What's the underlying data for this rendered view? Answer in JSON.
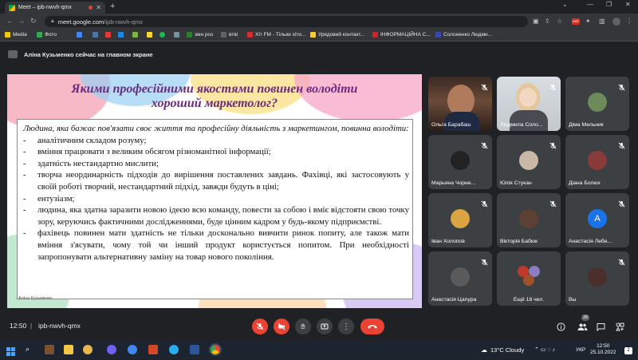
{
  "browser": {
    "tab_title": "Meet – ipb-nwvh-qmx",
    "url_host": "meet.google.com",
    "url_path": "/ipb-nwvh-qmx"
  },
  "bookmarks": [
    {
      "label": "Media",
      "color": "#f1c40f"
    },
    {
      "label": "Фото",
      "color": "#34a853"
    },
    {
      "label": "",
      "color": "#4285f4"
    },
    {
      "label": "",
      "color": "#4a76a8"
    },
    {
      "label": "",
      "color": "#e53935"
    },
    {
      "label": "",
      "color": "#1e88e5"
    },
    {
      "label": "",
      "color": "#7cb342"
    },
    {
      "label": "",
      "color": "#fdd835"
    },
    {
      "label": "",
      "color": "#1db954"
    },
    {
      "label": "",
      "color": "#78909c"
    },
    {
      "label": "змн роз",
      "color": "#2e7d32"
    },
    {
      "label": "втві",
      "color": "#5f6368"
    },
    {
      "label": "Хіт FM - Тільки хіти...",
      "color": "#d32f2f"
    },
    {
      "label": "Урядовий контакт...",
      "color": "#ffca28"
    },
    {
      "label": "ІНФОРМАЦІЙНА С...",
      "color": "#c62828"
    },
    {
      "label": "Солоненко Людми...",
      "color": "#3949ab"
    }
  ],
  "banner": "Аліна Кузьменко сейчас на главном экране",
  "slide": {
    "title": "Якими професійними якостями повинен володіти хороший маркетолог?",
    "intro": "Людина, яка бажає пов'язати своє життя та професійну діяльність з маркетингом, повинна володіти:",
    "items": [
      "аналітичним складом розуму;",
      "вміння працювати з великим обсягом різноманітної інформації;",
      "здатність нестандартно мислити;",
      "творча неординарність підходів до вирішення поставлених завдань. Фахівці, які застосовують у своїй роботі творчий, нестандартний підхід, завжди будуть в ціні;",
      "ентузіазм;",
      "людина, яка здатна заразити новою ідеєю всю команду, повести за собою і вміє відстояти свою точку зору, керуючись фактичними дослідженнями, буде цінним кадром у будь-якому підприємстві.",
      "фахівець повинен мати здатність не тільки досконально вивчити ринок попиту, але також мати вміння з'ясувати, чому той чи інший продукт користується попитом. При необхідності запропонувати альтернативну заміну на товар нового покоління."
    ],
    "caption": "Аліна Кузьменко"
  },
  "participants": [
    {
      "name": "Ольга Барабаш",
      "type": "video"
    },
    {
      "name": "Людмила Соло...",
      "type": "video"
    },
    {
      "name": "Діма Мельник",
      "type": "avatar",
      "color": "#6d8a5a"
    },
    {
      "name": "Марьяна Чорне...",
      "type": "avatar",
      "color": "#222222"
    },
    {
      "name": "Юлія Стукан",
      "type": "avatar",
      "color": "#c9b8a6"
    },
    {
      "name": "Діана Болюх",
      "type": "avatar",
      "color": "#8b3a3a"
    },
    {
      "name": "Іван Холопов",
      "type": "avatar",
      "color": "#d9a441"
    },
    {
      "name": "Вікторія Бабюк",
      "type": "avatar",
      "color": "#5c4033"
    },
    {
      "name": "Анастасія Лебе...",
      "type": "letter",
      "letter": "А",
      "color": "#1a73e8"
    },
    {
      "name": "Анастасія Цапура",
      "type": "avatar",
      "color": "#5a5a5a"
    },
    {
      "name": "Ещё 18 чел.",
      "type": "more"
    },
    {
      "name": "Вы",
      "type": "avatar",
      "color": "#4a2f2a"
    }
  ],
  "bottombar": {
    "time": "12:50",
    "separator": "|",
    "meeting_code": "ipb-nwvh-qmx",
    "participants_badge": "28"
  },
  "taskbar": {
    "weather": "13°C  Cloudy",
    "lang": "УКР",
    "time": "12:50",
    "date": "25.10.2022",
    "notifications": "2"
  }
}
